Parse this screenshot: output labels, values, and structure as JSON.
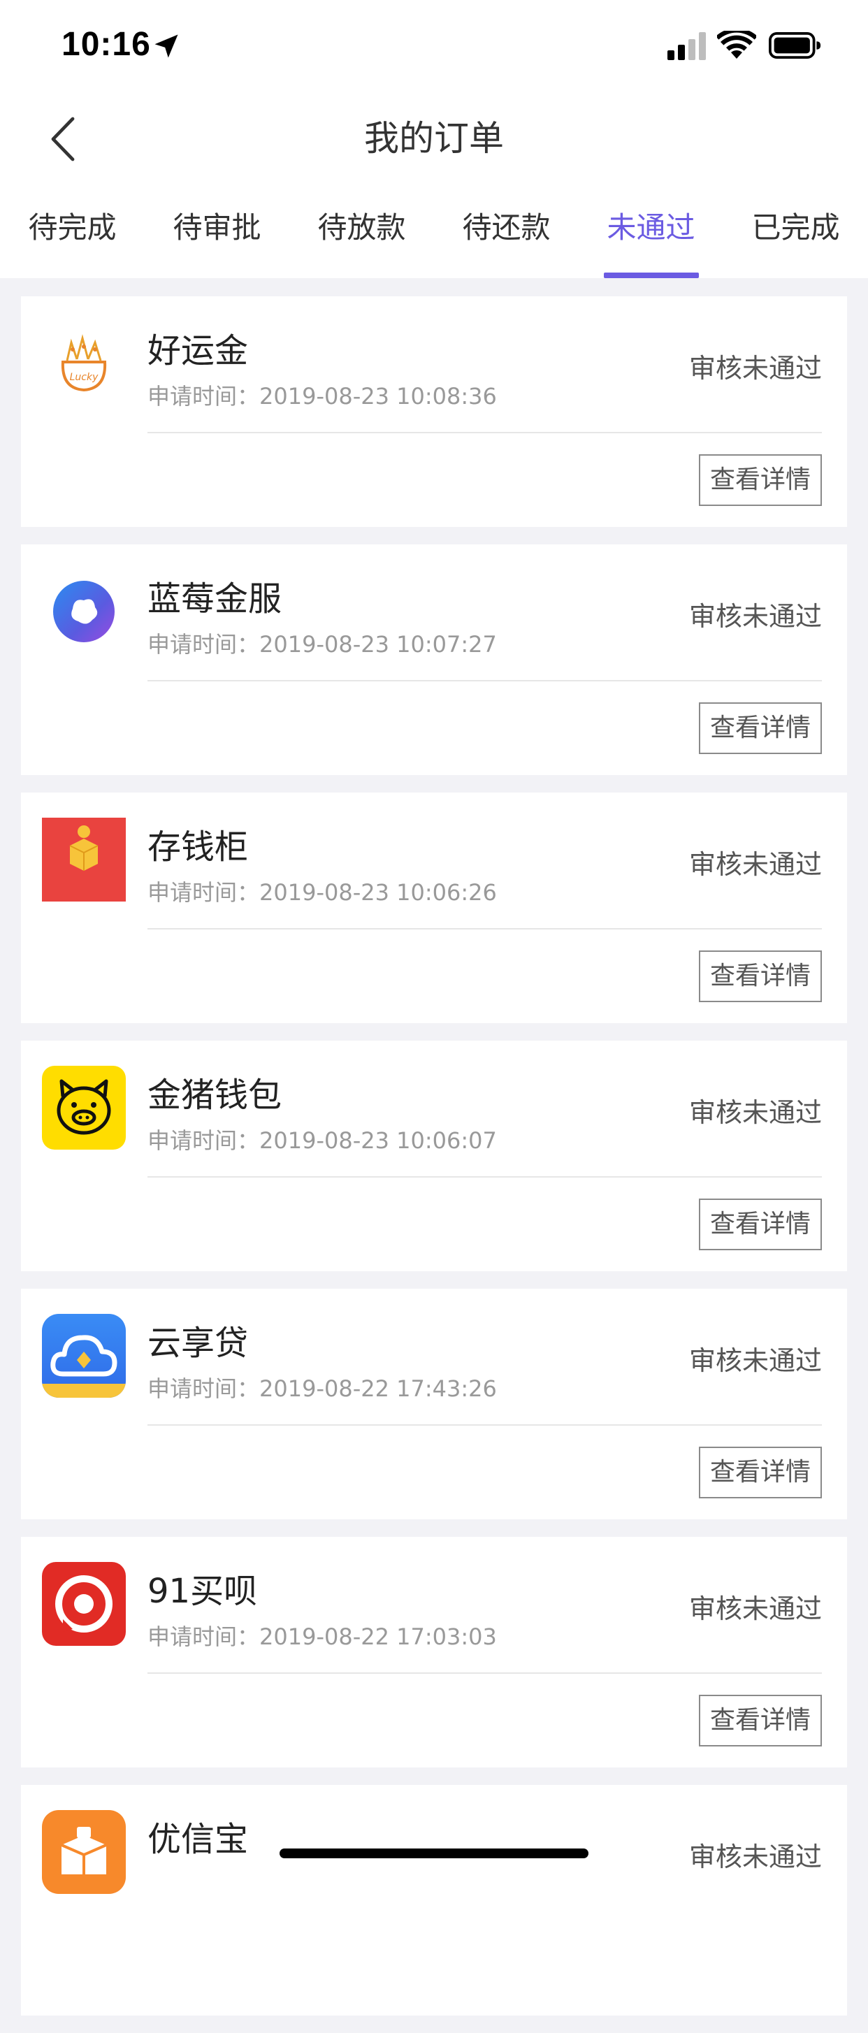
{
  "status_bar": {
    "time": "10:16"
  },
  "nav": {
    "title": "我的订单"
  },
  "tabs": [
    {
      "label": "待完成",
      "active": false
    },
    {
      "label": "待审批",
      "active": false
    },
    {
      "label": "待放款",
      "active": false
    },
    {
      "label": "待还款",
      "active": false
    },
    {
      "label": "未通过",
      "active": true
    },
    {
      "label": "已完成",
      "active": false
    }
  ],
  "colors": {
    "accent": "#6B5BE2",
    "background": "#F2F2F6"
  },
  "orders": [
    {
      "name": "好运金",
      "time": "申请时间：2019-08-23 10:08:36",
      "status": "审核未通过",
      "button": "查看详情",
      "logo": "lucky-bag-icon"
    },
    {
      "name": "蓝莓金服",
      "time": "申请时间：2019-08-23 10:07:27",
      "status": "审核未通过",
      "button": "查看详情",
      "logo": "blueberry-icon"
    },
    {
      "name": "存钱柜",
      "time": "申请时间：2019-08-23 10:06:26",
      "status": "审核未通过",
      "button": "查看详情",
      "logo": "coin-box-icon"
    },
    {
      "name": "金猪钱包",
      "time": "申请时间：2019-08-23 10:06:07",
      "status": "审核未通过",
      "button": "查看详情",
      "logo": "pig-icon"
    },
    {
      "name": "云享贷",
      "time": "申请时间：2019-08-22 17:43:26",
      "status": "审核未通过",
      "button": "查看详情",
      "logo": "cloud-icon"
    },
    {
      "name": "91买呗",
      "time": "申请时间：2019-08-22 17:03:03",
      "status": "审核未通过",
      "button": "查看详情",
      "logo": "target-icon"
    },
    {
      "name": "优信宝",
      "time": "",
      "status": "审核未通过",
      "button": "",
      "logo": "box-icon"
    }
  ]
}
